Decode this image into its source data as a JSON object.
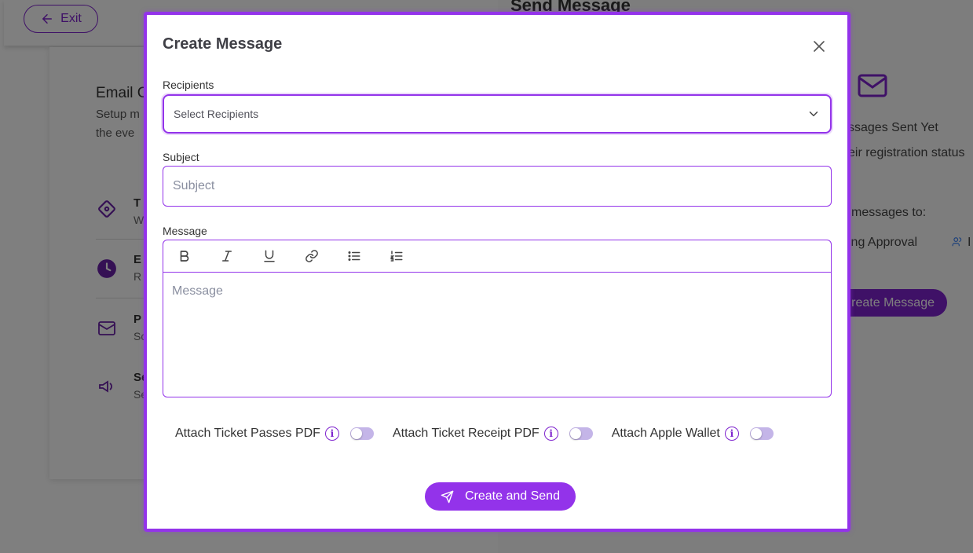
{
  "background": {
    "exit_label": "Exit",
    "email_title": "Email C",
    "email_subtitle_line1": "Setup m",
    "email_subtitle_line2": "the eve",
    "list_items": [
      {
        "title": "T",
        "subtitle": "W",
        "icon": "ticket-icon"
      },
      {
        "title": "E",
        "subtitle": "R",
        "icon": "clock-icon"
      },
      {
        "title": "P",
        "subtitle": "Sc",
        "icon": "mail-heart-icon"
      },
      {
        "title": "Se",
        "subtitle": "Se",
        "icon": "megaphone-icon"
      }
    ],
    "send_title": "Send Message",
    "no_messages": "ssages Sent Yet",
    "registration_text": "eir registration status",
    "messages_to": "messages to:",
    "pending_approval": "ing Approval",
    "pending_trailing": "I",
    "create_message_btn": "reate Message"
  },
  "modal": {
    "title": "Create Message",
    "recipients_label": "Recipients",
    "recipients_placeholder": "Select Recipients",
    "subject_label": "Subject",
    "subject_placeholder": "Subject",
    "message_label": "Message",
    "message_placeholder": "Message",
    "toolbar": [
      "bold-icon",
      "italic-icon",
      "underline-icon",
      "link-icon",
      "bullet-list-icon",
      "numbered-list-icon"
    ],
    "toggles": [
      {
        "label": "Attach Ticket Passes PDF",
        "on": false
      },
      {
        "label": "Attach Ticket Receipt PDF",
        "on": false
      },
      {
        "label": "Attach Apple Wallet",
        "on": false
      }
    ],
    "info_glyph": "i",
    "send_label": "Create and Send"
  },
  "colors": {
    "accent": "#9333ea",
    "accent_dark": "#7e22ce",
    "toggle_off": "#c4b5e8"
  }
}
